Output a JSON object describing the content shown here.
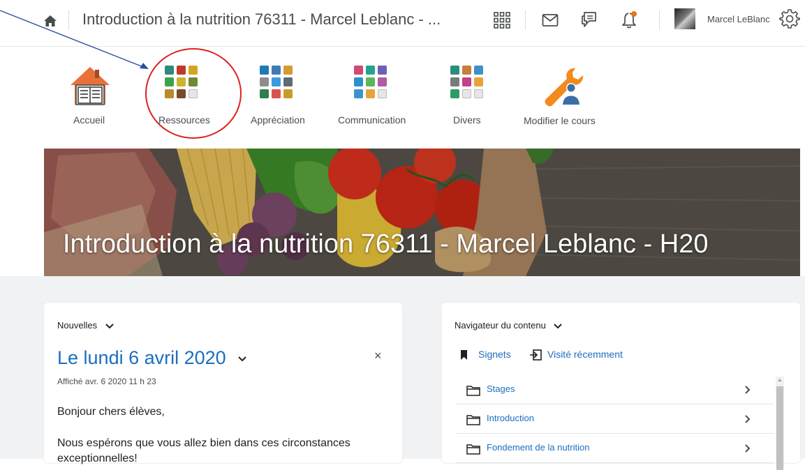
{
  "topbar": {
    "course_title": "Introduction à la nutrition 76311 - Marcel Leblanc - ...",
    "user_name": "Marcel LeBlanc"
  },
  "navbar": {
    "items": [
      {
        "label": "Accueil",
        "icon": "house-icon"
      },
      {
        "label": "Ressources",
        "icon": "resources-grid-icon"
      },
      {
        "label": "Appréciation",
        "icon": "assessment-grid-icon"
      },
      {
        "label": "Communication",
        "icon": "communication-grid-icon"
      },
      {
        "label": "Divers",
        "icon": "misc-grid-icon"
      },
      {
        "label": "Modifier le cours",
        "icon": "wrench-user-icon"
      }
    ]
  },
  "banner": {
    "title": "Introduction à la nutrition 76311 - Marcel Leblanc - H20"
  },
  "news": {
    "heading": "Nouvelles",
    "date_title": "Le lundi 6 avril 2020",
    "close_glyph": "×",
    "meta": "Affiché avr. 6 2020 11 h 23",
    "paragraph1": "Bonjour chers élèves,",
    "paragraph2": "Nous espérons que vous allez bien dans ces circonstances exceptionnelles!"
  },
  "content_nav": {
    "heading": "Navigateur du contenu",
    "bookmarks_label": "Signets",
    "recent_label": "Visité récemment",
    "modules": [
      "Stages",
      "Introduction",
      "Fondement de la nutrition"
    ]
  },
  "colors": {
    "link": "#1c6ebf",
    "notification_dot": "#e87511",
    "annotation": "#dd2222",
    "arrow": "#2a4fa0"
  }
}
